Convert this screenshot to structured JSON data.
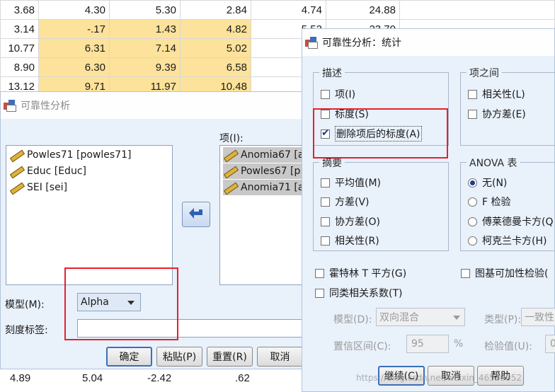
{
  "grid": {
    "rows": [
      [
        "3.68",
        "4.30",
        "5.30",
        "2.84",
        "4.74",
        "24.88"
      ],
      [
        "3.14",
        "-.17",
        "1.43",
        "4.82",
        "5.52",
        "23.70"
      ],
      [
        "10.77",
        "6.31",
        "7.14",
        "5.02",
        "",
        ""
      ],
      [
        "8.90",
        "6.30",
        "9.39",
        "6.58",
        "",
        ""
      ],
      [
        "13.12",
        "9.71",
        "11.97",
        "10.48",
        "",
        ""
      ]
    ],
    "bottom_row": [
      "4.89",
      "5.04",
      "-2.42",
      ".62"
    ]
  },
  "main_dialog": {
    "title": "可靠性分析",
    "items_label": "项(I):",
    "source_variables": [
      "Powles71 [powles71]",
      "Educ [Educ]",
      "SEI [sei]"
    ],
    "target_items": [
      "Anomia67 [a",
      "Powles67 [p",
      "Anomia71 [a"
    ],
    "model_label": "模型(M):",
    "model_value": "Alpha",
    "scale_label_label": "刻度标签:",
    "scale_label_value": "",
    "buttons": {
      "ok": "确定",
      "paste": "粘贴(P)",
      "reset": "重置(R)",
      "cancel": "取消"
    }
  },
  "stats_dialog": {
    "title": "可靠性分析：统计",
    "descriptives": {
      "legend": "描述",
      "item": "项(I)",
      "scale": "标度(S)",
      "scale_if_deleted": "删除项后的标度(A)"
    },
    "inter_item": {
      "legend": "项之间",
      "correlations": "相关性(L)",
      "covariances": "协方差(E)"
    },
    "summaries": {
      "legend": "摘要",
      "means": "平均值(M)",
      "variances": "方差(V)",
      "covariances": "协方差(O)",
      "correlations": "相关性(R)"
    },
    "anova": {
      "legend": "ANOVA 表",
      "none": "无(N)",
      "f_test": "F 检验",
      "friedman": "傅莱德曼卡方(Q",
      "cochran": "柯克兰卡方(H)"
    },
    "hotelling": "霍特林 T 平方(G)",
    "tukey": "图基可加性检验(",
    "icc": "同类相关系数(T)",
    "model_label": "模型(D):",
    "model_value": "双向混合",
    "type_label": "类型(P):",
    "type_value": "一致性",
    "ci_label": "置信区间(C):",
    "ci_value": "95",
    "ci_unit": "%",
    "test_value_label": "检验值(U):",
    "test_value": "0",
    "buttons": {
      "continue": "继续(C)",
      "cancel": "取消",
      "help": "帮助"
    }
  },
  "watermark": "https://blog.csdn.net/weixin_46539952"
}
